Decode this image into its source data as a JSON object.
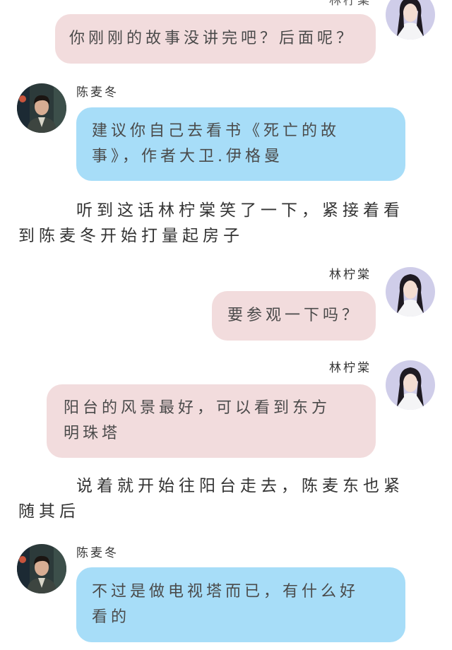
{
  "characters": {
    "female": {
      "name": "林柠棠",
      "avatar_icon": "female-avatar-icon"
    },
    "male": {
      "name": "陈麦冬",
      "avatar_icon": "male-avatar-icon"
    }
  },
  "messages": [
    {
      "speaker": "林柠棠",
      "text": "你刚刚的故事没讲完吧？后面呢？",
      "bubble_color": "#f2dcdd"
    },
    {
      "speaker": "陈麦冬",
      "text": "建议你自己去看书《死亡的故事》，作者大卫.伊格曼",
      "bubble_color": "#a7ddf8"
    },
    {
      "speaker": "林柠棠",
      "text": "要参观一下吗？",
      "bubble_color": "#f2dcdd"
    },
    {
      "speaker": "林柠棠",
      "text": "阳台的风景最好，可以看到东方明珠塔",
      "bubble_color": "#f2dcdd"
    },
    {
      "speaker": "陈麦冬",
      "text": "不过是做电视塔而已，有什么好看的",
      "bubble_color": "#a7ddf8"
    }
  ],
  "narration": [
    {
      "text": "听到这话林柠棠笑了一下，紧接着看到陈麦冬开始打量起房子"
    },
    {
      "text": "说着就开始往阳台走去，陈麦东也紧随其后"
    }
  ]
}
